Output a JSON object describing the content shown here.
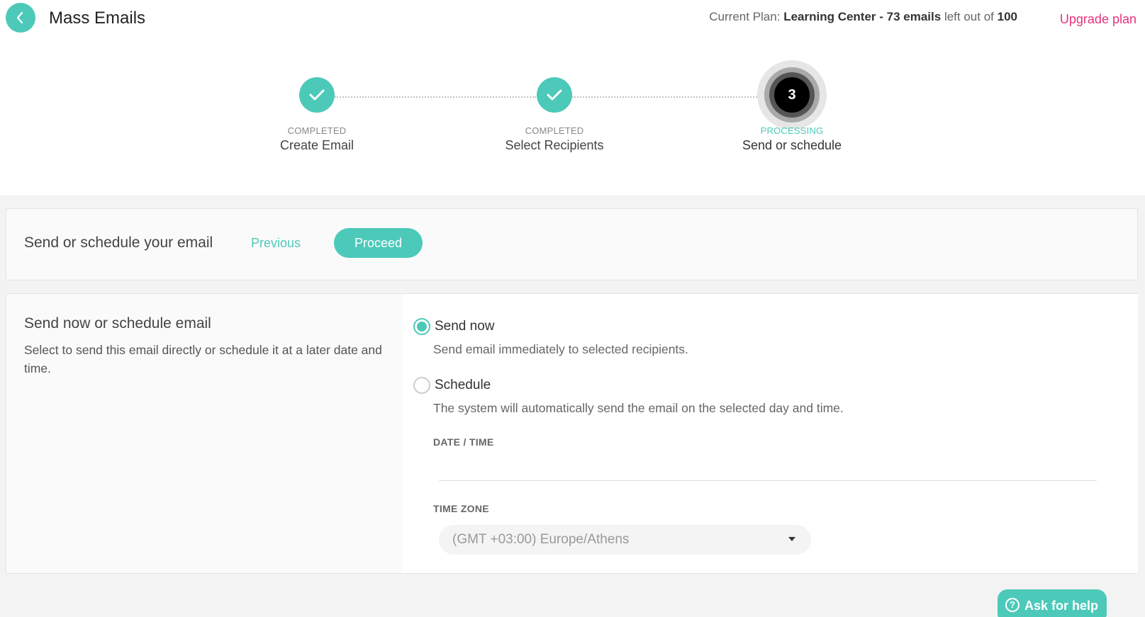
{
  "header": {
    "title": "Mass Emails",
    "plan_prefix": "Current Plan:",
    "plan_name": "Learning Center - 73 emails",
    "plan_middle": "left out of",
    "plan_total": "100",
    "upgrade_label": "Upgrade plan"
  },
  "stepper": {
    "steps": [
      {
        "status": "COMPLETED",
        "label": "Create Email"
      },
      {
        "status": "COMPLETED",
        "label": "Select Recipients"
      },
      {
        "status": "PROCESSING",
        "label": "Send or schedule",
        "number": "3"
      }
    ]
  },
  "action_bar": {
    "title": "Send or schedule your email",
    "previous_label": "Previous",
    "proceed_label": "Proceed"
  },
  "panel": {
    "title": "Send now or schedule email",
    "description": "Select to send this email directly or schedule it at a later date and time.",
    "options": [
      {
        "label": "Send now",
        "description": "Send email immediately to selected recipients.",
        "checked": true
      },
      {
        "label": "Schedule",
        "description": "The system will automatically send the email on the selected day and time.",
        "checked": false
      }
    ],
    "date_time_label": "DATE / TIME",
    "date_time_value": "",
    "time_zone_label": "TIME ZONE",
    "time_zone_value": "(GMT +03:00) Europe/Athens"
  },
  "help": {
    "label": "Ask for help",
    "icon_glyph": "?"
  },
  "colors": {
    "accent": "#4cc9b9",
    "upgrade": "#e5337b"
  },
  "icons": {
    "back": "chevron-left-icon",
    "completed": "check-icon",
    "dropdown": "caret-down-icon",
    "help": "question-circle-icon"
  }
}
